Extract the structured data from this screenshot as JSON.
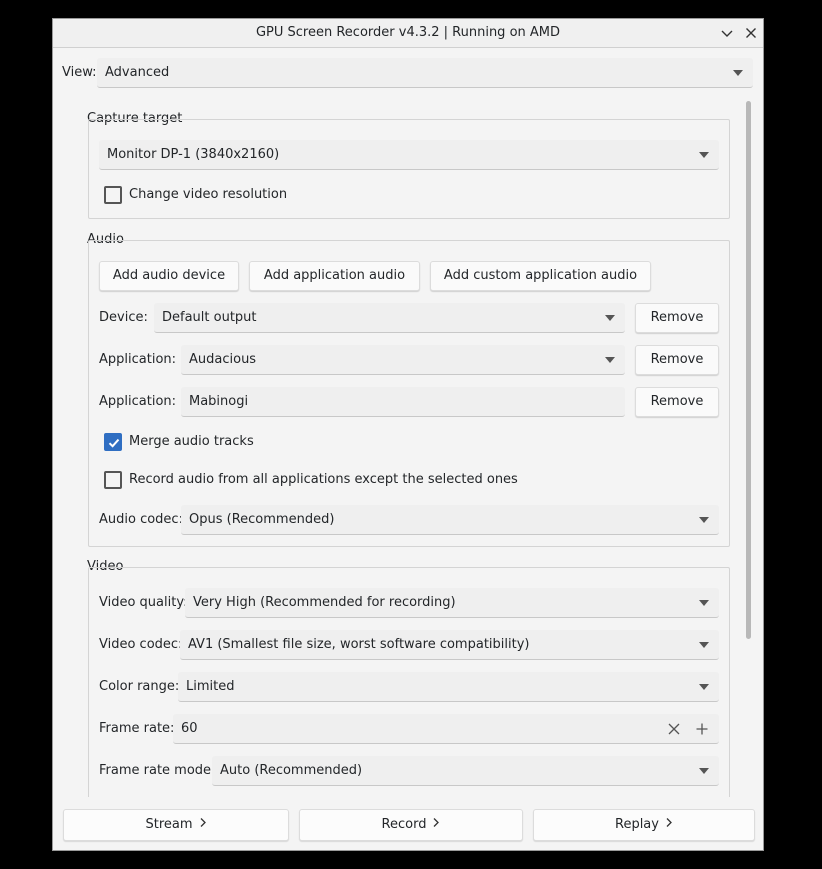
{
  "window": {
    "title": "GPU Screen Recorder v4.3.2 | Running on AMD"
  },
  "view": {
    "label": "View:",
    "value": "Advanced"
  },
  "capture": {
    "title": "Capture target",
    "target": "Monitor DP-1 (3840x2160)",
    "change_resolution": {
      "label": "Change video resolution",
      "checked": false
    }
  },
  "audio": {
    "title": "Audio",
    "add_device_label": "Add audio device",
    "add_app_label": "Add application audio",
    "add_custom_label": "Add custom application audio",
    "rows": [
      {
        "label": "Device:",
        "value": "Default output",
        "remove": "Remove"
      },
      {
        "label": "Application:",
        "value": "Audacious",
        "remove": "Remove"
      },
      {
        "label": "Application:",
        "value": "Mabinogi",
        "remove": "Remove"
      }
    ],
    "merge": {
      "label": "Merge audio tracks",
      "checked": true
    },
    "record_except": {
      "label": "Record audio from all applications except the selected ones",
      "checked": false
    },
    "codec": {
      "label": "Audio codec:",
      "value": "Opus (Recommended)"
    }
  },
  "video": {
    "title": "Video",
    "quality": {
      "label": "Video quality:",
      "value": "Very High (Recommended for recording)"
    },
    "codec": {
      "label": "Video codec:",
      "value": "AV1 (Smallest file size, worst software compatibility)"
    },
    "color_range": {
      "label": "Color range:",
      "value": "Limited"
    },
    "frame_rate": {
      "label": "Frame rate:",
      "value": "60"
    },
    "frame_rate_mode": {
      "label": "Frame rate mode:",
      "value": "Auto (Recommended)"
    }
  },
  "bottom": {
    "stream": "Stream",
    "record": "Record",
    "replay": "Replay"
  },
  "colors": {
    "accent": "#2f6ec2",
    "window_bg": "#f4f4f4"
  }
}
